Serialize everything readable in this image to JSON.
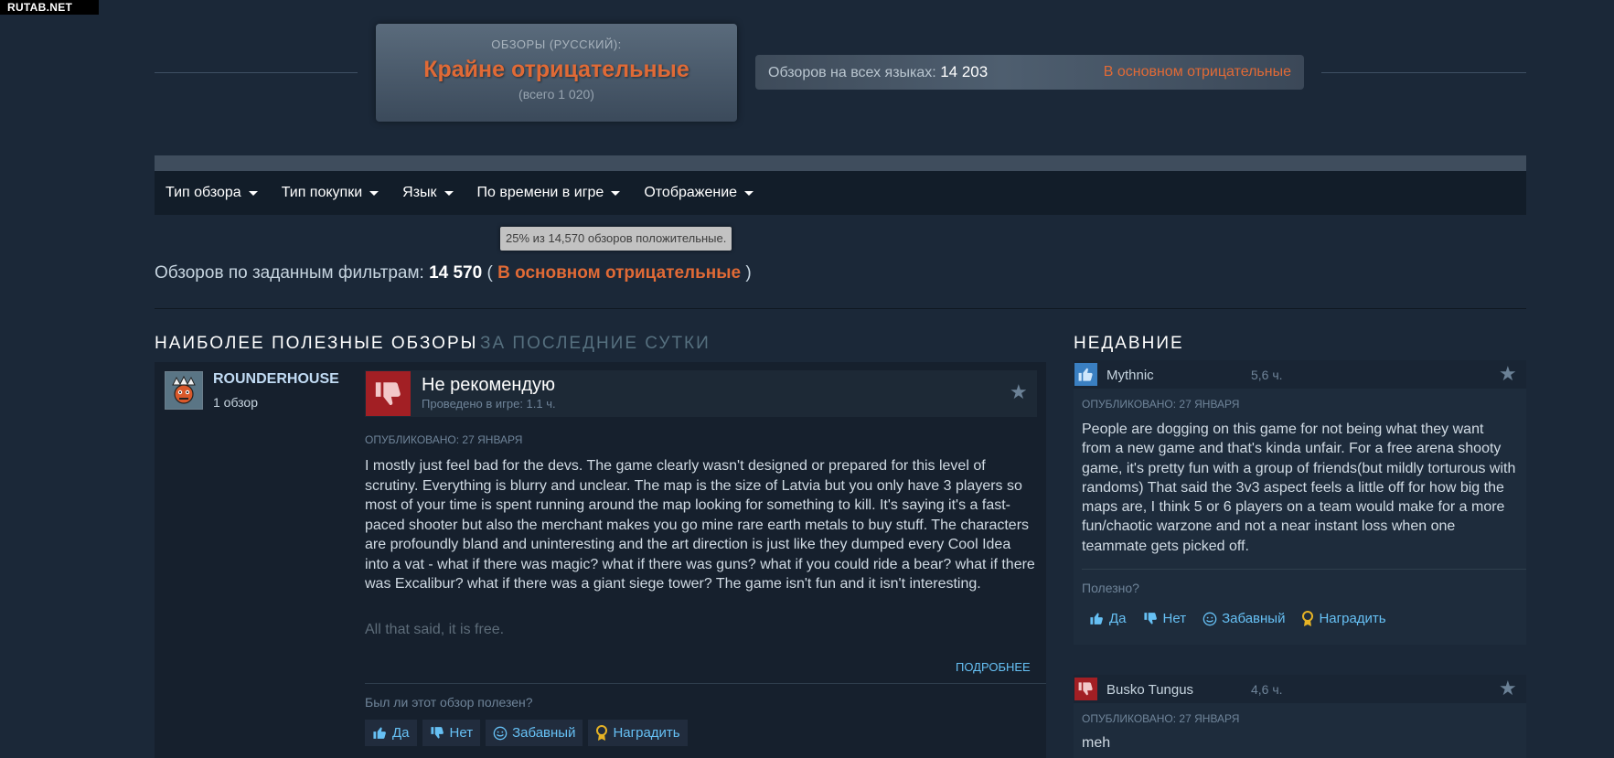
{
  "watermark": "RUTAB.NET",
  "summary": {
    "label": "ОБЗОРЫ (РУССКИЙ):",
    "rating": "Крайне отрицательные",
    "total": "(всего 1 020)"
  },
  "all_languages": {
    "label": "Обзоров на всех языках:",
    "count": "14 203",
    "rating": "В основном отрицательные"
  },
  "filters": [
    {
      "label": "Тип обзора"
    },
    {
      "label": "Тип покупки"
    },
    {
      "label": "Язык"
    },
    {
      "label": "По времени в игре"
    },
    {
      "label": "Отображение"
    }
  ],
  "tooltip": "25% из 14,570 обзоров положительные.",
  "filtered": {
    "label": "Обзоров по заданным фильтрам:",
    "count": "14 570",
    "open": "(",
    "rating": "В основном отрицательные",
    "close": ")"
  },
  "sections": {
    "helpful": "НАИБОЛЕЕ ПОЛЕЗНЫЕ ОБЗОРЫ",
    "last_day": "ЗА ПОСЛЕДНИЕ СУТКИ",
    "recent": "НЕДАВНИЕ"
  },
  "main_review": {
    "author": "ROUNDERHOUSE",
    "author_reviews": "1 обзор",
    "verdict": "Не рекомендую",
    "hours": "Проведено в игре: 1.1 ч.",
    "posted": "ОПУБЛИКОВАНО: 27 ЯНВАРЯ",
    "body": "I mostly just feel bad for the devs. The game clearly wasn't designed or prepared for this level of scrutiny. Everything is blurry and unclear. The map is the size of Latvia but you only have 3 players so most of your time is spent running around the map looking for something to kill. It's saying it's a fast-paced shooter but also the merchant makes you go mine rare earth metals to buy stuff. The characters are profoundly bland and uninteresting and the art direction is just like they dumped every Cool Idea into a vat - what if there was magic? what if there was guns? what if you could ride a bear? what if there was Excalibur? what if there was a giant siege tower? The game isn't fun and it isn't interesting.",
    "fade_text": "All that said, it is free.",
    "more": "ПОДРОБНЕЕ",
    "helpful_q": "Был ли этот обзор полезен?",
    "votes": {
      "yes": "Да",
      "no": "Нет",
      "funny": "Забавный",
      "award": "Наградить"
    }
  },
  "recent_reviews": [
    {
      "author": "Mythnic",
      "hours": "5,6 ч.",
      "verdict_icon": "thumbs-up",
      "posted": "ОПУБЛИКОВАНО: 27 ЯНВАРЯ",
      "body": "People are dogging on this game for not being what they want from a new game and that's kinda unfair. For a free arena shooty game, it's pretty fun with a group of friends(but mildly torturous with randoms) That said the 3v3 aspect feels a little off for how big the maps are, I think 5 or 6 players on a team would make for a more fun/chaotic warzone and not a near instant loss when one teammate gets picked off.",
      "helpful_q": "Полезно?",
      "votes": {
        "yes": "Да",
        "no": "Нет",
        "funny": "Забавный",
        "award": "Наградить"
      }
    },
    {
      "author": "Busko Tungus",
      "hours": "4,6 ч.",
      "verdict_icon": "thumbs-down",
      "posted": "ОПУБЛИКОВАНО: 27 ЯНВАРЯ",
      "body": "meh"
    }
  ],
  "colors": {
    "background": "#1b2838",
    "negative": "#e06a36",
    "link": "#66c0f4",
    "thumb_down": "#a21f24",
    "thumb_up": "#3a7fc1"
  }
}
